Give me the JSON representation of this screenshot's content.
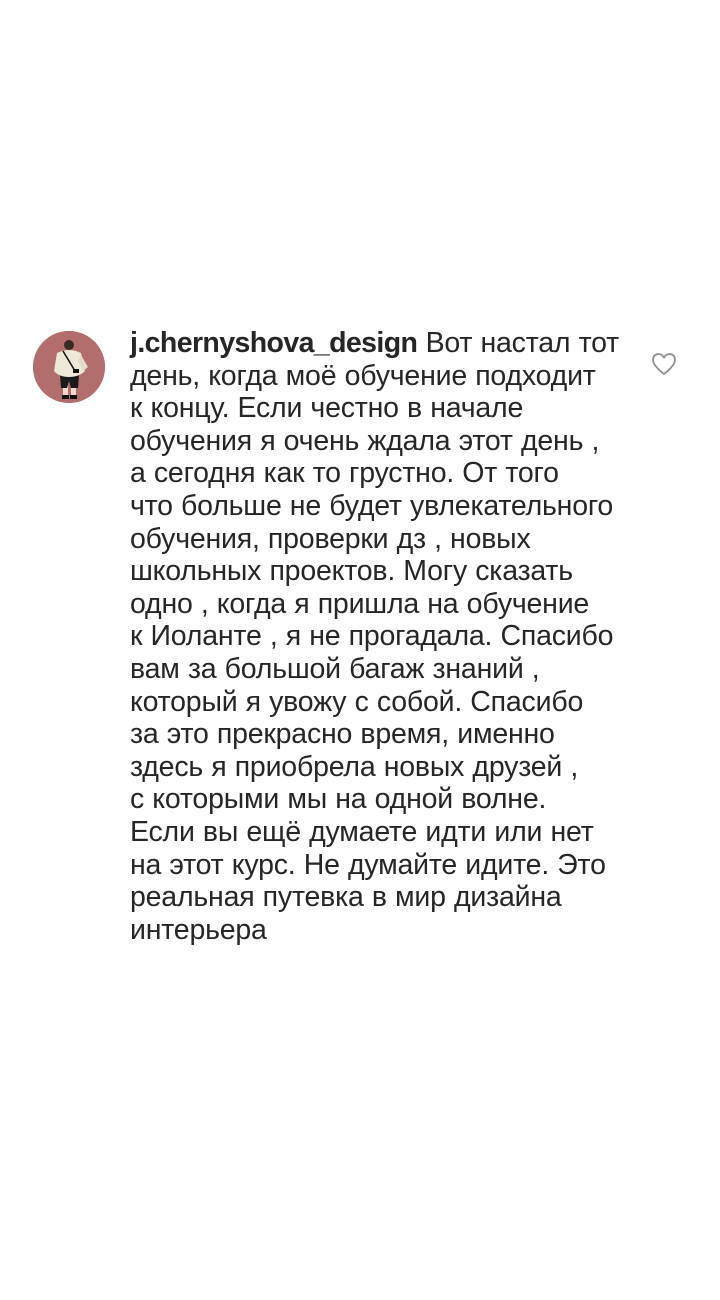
{
  "comment": {
    "username": "j.chernyshova_design",
    "lines": [
      " Вот настал тот",
      "день, когда моё обучение подходит",
      "к концу. Если честно в начале",
      "обучения я очень ждала этот день ,",
      "а сегодня как то грустно. От того",
      "что больше не будет увлекательного",
      "обучения, проверки дз , новых",
      "школьных проектов. Могу сказать",
      "одно , когда я пришла на обучение",
      "к Иоланте , я не прогадала. Спасибо",
      "вам за большой багаж знаний ,",
      "который я увожу с собой. Спасибо",
      "за это прекрасно время, именно",
      "здесь я приобрела новых друзей ,",
      "с которыми мы на одной волне.",
      "Если вы ещё думаете идти или нет",
      "на этот курс. Не думайте идите. Это",
      "реальная путевка в мир дизайна",
      "интерьера"
    ],
    "like_icon": "heart-outline-icon",
    "avatar_color": "#b36d6c"
  }
}
